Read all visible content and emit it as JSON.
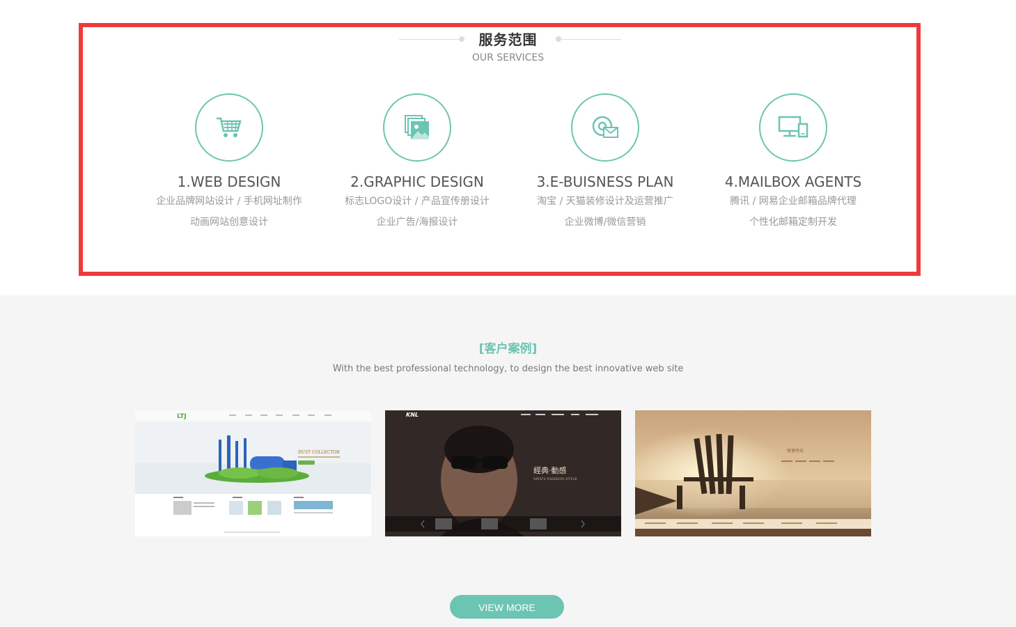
{
  "services": {
    "title": "服务范围",
    "subtitle": "OUR SERVICES",
    "items": [
      {
        "icon": "shopping-cart-icon",
        "name": "1.WEB DESIGN",
        "line1": "企业品牌网站设计 / 手机网址制作",
        "line2": "动画网站创意设计"
      },
      {
        "icon": "image-gallery-icon",
        "name": "2.GRAPHIC DESIGN",
        "line1": "标志LOGO设计 / 产品宣传册设计",
        "line2": "企业广告/海报设计"
      },
      {
        "icon": "email-at-icon",
        "name": "3.E-BUISNESS PLAN",
        "line1": "淘宝 / 天猫装修设计及运营推广",
        "line2": "企业微博/微信营销"
      },
      {
        "icon": "devices-icon",
        "name": "4.MAILBOX AGENTS",
        "line1": "腾讯 / 网易企业邮箱品牌代理",
        "line2": "个性化邮箱定制开发"
      }
    ]
  },
  "cases": {
    "title": "[客户案例]",
    "subtitle": "With the best professional technology, to design the best innovative web site",
    "more_label": "VIEW MORE",
    "thumbs": [
      {
        "logo": "LTJ",
        "headline": "DUST COLLECTOR"
      },
      {
        "logo": "KNL",
        "headline": "經典·動感",
        "sub": "MEN'S FASHION STYLE"
      },
      {
        "headline": "悦享时光"
      }
    ]
  },
  "colors": {
    "accent": "#6cc4b2",
    "highlight": "#ee3a3a"
  }
}
